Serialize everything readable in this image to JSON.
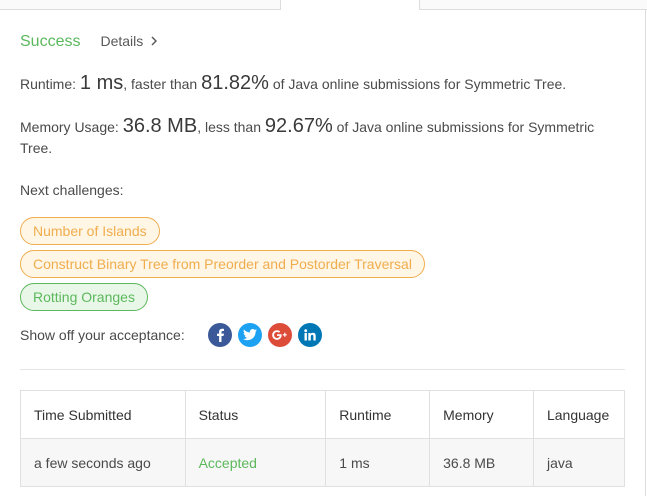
{
  "status": {
    "result": "Success",
    "details_label": "Details"
  },
  "runtime": {
    "label": "Runtime:",
    "value": "1 ms",
    "comparison": ", faster than",
    "percent": "81.82%",
    "suffix": "of Java online submissions for Symmetric Tree."
  },
  "memory": {
    "label": "Memory Usage:",
    "value": "36.8 MB",
    "comparison": ", less than",
    "percent": "92.67%",
    "suffix": "of Java online submissions for Symmetric Tree."
  },
  "next_challenges": {
    "label": "Next challenges:",
    "items": [
      {
        "title": "Number of Islands",
        "difficulty_color": "#f0ad4e"
      },
      {
        "title": "Construct Binary Tree from Preorder and Postorder Traversal",
        "difficulty_color": "#f0ad4e"
      },
      {
        "title": "Rotting Oranges",
        "difficulty_color": "#5cb85c"
      }
    ]
  },
  "share": {
    "label": "Show off your acceptance:",
    "icons": [
      "facebook-icon",
      "twitter-icon",
      "google-plus-icon",
      "linkedin-icon"
    ]
  },
  "submissions_table": {
    "headers": [
      "Time Submitted",
      "Status",
      "Runtime",
      "Memory",
      "Language"
    ],
    "rows": [
      {
        "time": "a few seconds ago",
        "status": "Accepted",
        "runtime": "1 ms",
        "memory": "36.8 MB",
        "language": "java"
      }
    ]
  },
  "colors": {
    "success": "#5cb85c",
    "medium": "#f0ad4e",
    "facebook": "#3b5998",
    "twitter": "#1da1f2",
    "google_plus": "#dd4b39",
    "linkedin": "#0077b5"
  }
}
